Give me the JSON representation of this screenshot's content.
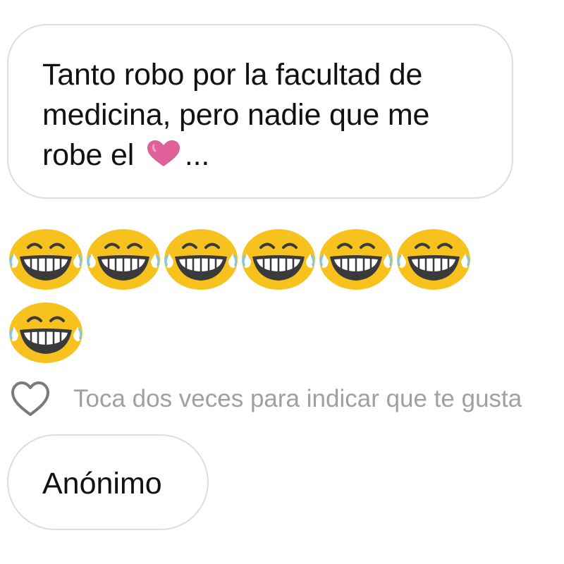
{
  "message": {
    "text_before_heart": "Tanto robo por la facultad de medicina, pero nadie que me robe el",
    "text_after_heart": "...",
    "heart_icon": "pink-heart-icon",
    "heart_color": "#e0609a"
  },
  "reactions": {
    "emoji_icon": "face-with-tears-of-joy-icon",
    "count": 7,
    "emoji_color": "#f7c21d"
  },
  "like": {
    "icon": "heart-outline-icon",
    "hint": "Toca dos veces para indicar que te gusta"
  },
  "sender": {
    "name": "Anónimo"
  }
}
